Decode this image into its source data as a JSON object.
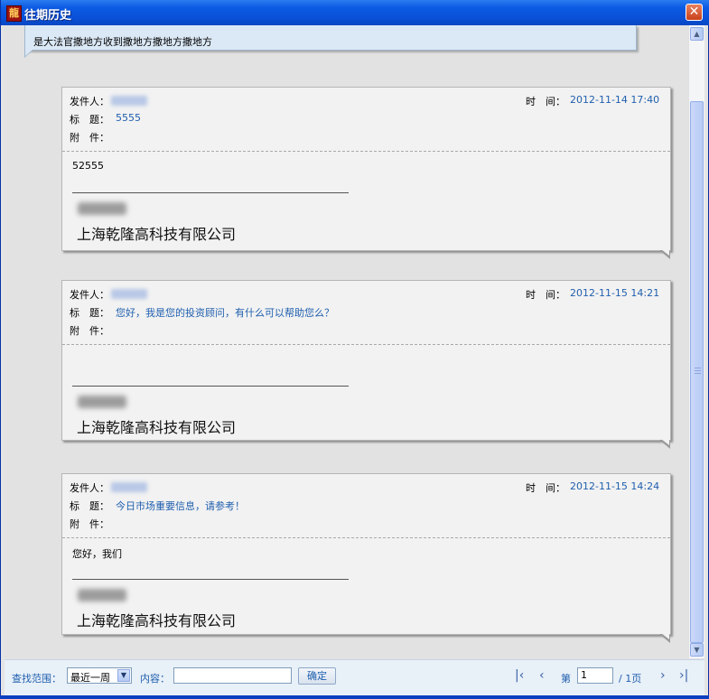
{
  "window": {
    "title": "往期历史",
    "app_icon_glyph": "龍",
    "close_glyph": "✕",
    "accent": "#0a50d8",
    "link_color": "#1f5fae"
  },
  "prev_message": {
    "text": "是大法官撒地方收到撒地方撒地方撒地方"
  },
  "labels": {
    "sender": "发件人：",
    "time": "时　间：",
    "subject": "标　题：",
    "attachment": "附　件："
  },
  "messages": [
    {
      "time": "2012-11-14 17:40",
      "subject": "5555",
      "body": "52555",
      "divider": "------------------------------------------------------------",
      "company": "上海乾隆高科技有限公司"
    },
    {
      "time": "2012-11-15 14:21",
      "subject": "您好，我是您的投资顾问，有什么可以帮助您么？",
      "body": "",
      "divider": "------------------------------------------------------------",
      "company": "上海乾隆高科技有限公司"
    },
    {
      "time": "2012-11-15 14:24",
      "subject": "今日市场重要信息，请参考！",
      "body": "您好，我们",
      "divider": "------------------------------------------------------------",
      "company": "上海乾隆高科技有限公司"
    }
  ],
  "toolbar": {
    "range_label": "查找范围：",
    "range_value": "最近一周",
    "content_label": "内容：",
    "content_value": "",
    "ok_label": "确定",
    "page_prefix": "第",
    "page_value": "1",
    "page_suffix": "/ 1页",
    "first_icon": "|‹",
    "prev_icon": "‹",
    "next_icon": "›",
    "last_icon": "›|"
  },
  "scrollbar": {
    "up_icon": "▲",
    "down_icon": "▼"
  }
}
